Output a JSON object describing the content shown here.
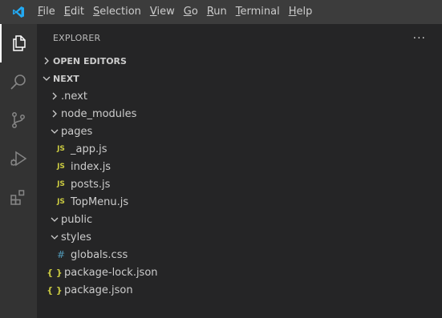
{
  "menu": {
    "items": [
      {
        "first": "F",
        "rest": "ile"
      },
      {
        "first": "E",
        "rest": "dit"
      },
      {
        "first": "S",
        "rest": "election"
      },
      {
        "first": "V",
        "rest": "iew"
      },
      {
        "first": "G",
        "rest": "o"
      },
      {
        "first": "R",
        "rest": "un"
      },
      {
        "first": "T",
        "rest": "erminal"
      },
      {
        "first": "H",
        "rest": "elp"
      }
    ]
  },
  "activity_bar": {
    "icons": [
      "files-icon",
      "search-icon",
      "source-control-icon",
      "run-debug-icon",
      "extensions-icon"
    ]
  },
  "sidebar": {
    "title": "EXPLORER",
    "more": "···",
    "open_editors": "OPEN EDITORS",
    "folder": "NEXT"
  },
  "tree": {
    "next_dir": ".next",
    "node_modules": "node_modules",
    "pages": "pages",
    "app_js": "_app.js",
    "index_js": "index.js",
    "posts_js": "posts.js",
    "topmenu_js": "TopMenu.js",
    "public": "public",
    "styles": "styles",
    "globals_css": "globals.css",
    "package_lock": "package-lock.json",
    "package_json": "package.json"
  },
  "icons": {
    "js": "JS",
    "css": "#",
    "json": "{ }"
  },
  "colors": {
    "titlebar": "#3c3c3c",
    "activitybar": "#333333",
    "sidebar": "#252526",
    "vscode_blue": "#23a9f2",
    "js_yellow": "#cbcb41",
    "css_blue": "#519aba"
  }
}
